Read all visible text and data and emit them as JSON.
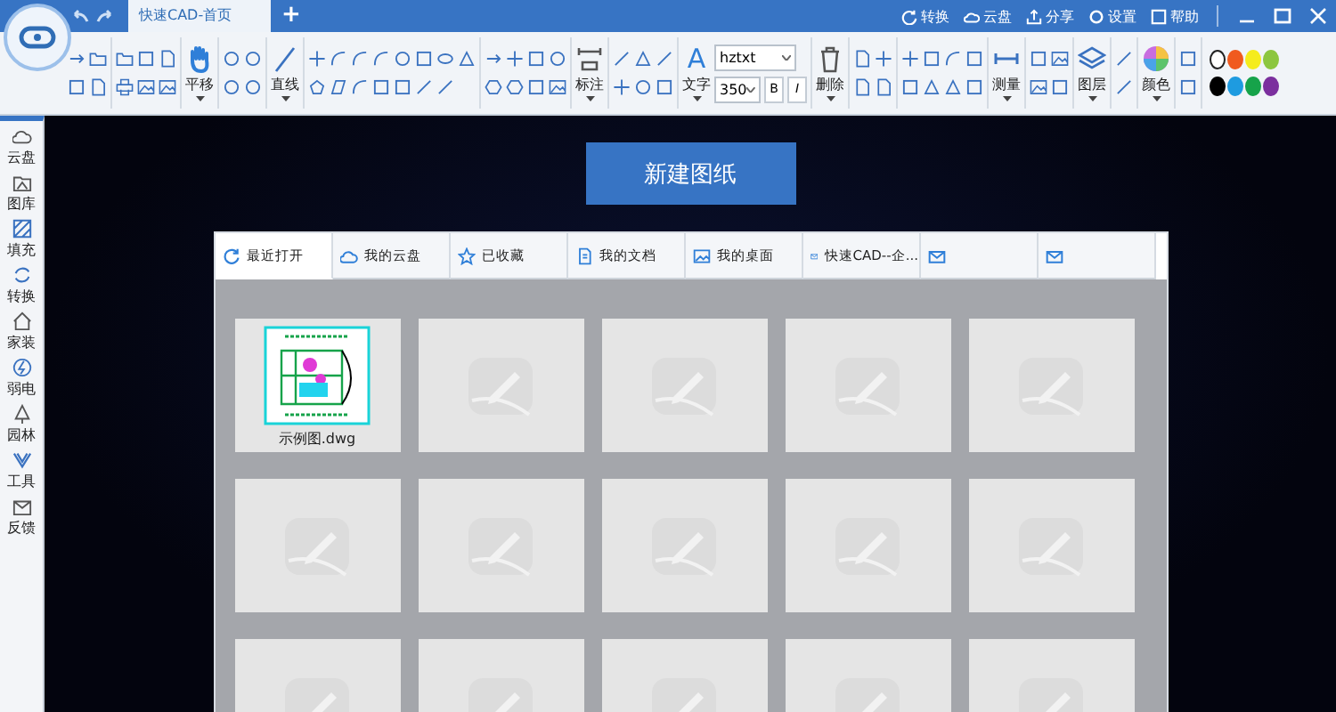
{
  "window": {
    "title_tab": "快速CAD-首页",
    "new_tab": "+",
    "actions": [
      {
        "label": "转换"
      },
      {
        "label": "云盘"
      },
      {
        "label": "分享"
      },
      {
        "label": "设置"
      },
      {
        "label": "帮助"
      }
    ]
  },
  "toolbar": {
    "labels": [
      "平移",
      "直线",
      "标注",
      "文字",
      "删除",
      "测量",
      "图层",
      "颜色"
    ],
    "text_icon": "A",
    "font": "hztxt",
    "size": "350",
    "bold": "B",
    "italic": "I",
    "palette": [
      {
        "color": "#ffffff",
        "selected": true
      },
      {
        "color": "#f05a1e",
        "selected": false
      },
      {
        "color": "#f5ec1c",
        "selected": false
      },
      {
        "color": "#8cc63f",
        "selected": false
      },
      {
        "color": "#000000",
        "selected": false
      },
      {
        "color": "#1e9be0",
        "selected": false
      },
      {
        "color": "#16a34a",
        "selected": false
      },
      {
        "color": "#7b2f9e",
        "selected": false
      }
    ]
  },
  "sidebar": {
    "items": [
      {
        "label": "云盘"
      },
      {
        "label": "图库"
      },
      {
        "label": "填充"
      },
      {
        "label": "转换"
      },
      {
        "label": "家装"
      },
      {
        "label": "弱电"
      },
      {
        "label": "园林"
      },
      {
        "label": "工具"
      },
      {
        "label": "反馈"
      }
    ]
  },
  "new_drawing_button": "新建图纸",
  "tabs": [
    {
      "label": "最近打开",
      "selected": true
    },
    {
      "label": "我的云盘",
      "selected": false
    },
    {
      "label": "已收藏",
      "selected": false
    },
    {
      "label": "我的文档",
      "selected": false
    },
    {
      "label": "我的桌面",
      "selected": false
    },
    {
      "label": "快速CAD--企...",
      "selected": false
    },
    {
      "selected": false
    },
    {
      "selected": false
    }
  ],
  "files": [
    {
      "kind": "drawing",
      "name": "示例图.dwg"
    },
    {
      "kind": "empty"
    },
    {
      "kind": "empty"
    },
    {
      "kind": "empty"
    },
    {
      "kind": "empty"
    },
    {
      "kind": "empty"
    },
    {
      "kind": "empty"
    },
    {
      "kind": "empty"
    },
    {
      "kind": "empty"
    },
    {
      "kind": "empty"
    },
    {
      "kind": "empty"
    },
    {
      "kind": "empty"
    },
    {
      "kind": "empty"
    },
    {
      "kind": "empty"
    },
    {
      "kind": "empty"
    }
  ]
}
